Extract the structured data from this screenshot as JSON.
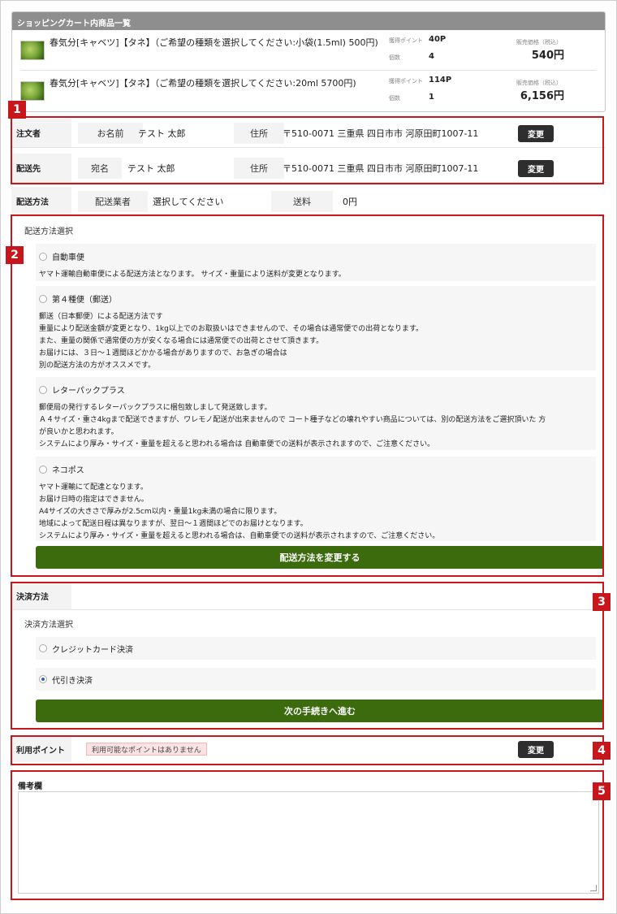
{
  "cart": {
    "header": "ショッピングカート内商品一覧",
    "items": [
      {
        "name": "春気分[キャベツ]【タネ】（ご希望の種類を選択してください:小袋(1.5ml) 500円)",
        "points_label": "獲得ポイント",
        "points": "40P",
        "qty_label": "個数",
        "qty": "4",
        "price_label": "販売価格（税込）",
        "price": "540円"
      },
      {
        "name": "春気分[キャベツ]【タネ】（ご希望の種類を選択してください:20ml 5700円)",
        "points_label": "獲得ポイント",
        "points": "114P",
        "qty_label": "個数",
        "qty": "1",
        "price_label": "販売価格（税込）",
        "price": "6,156円"
      }
    ]
  },
  "orderer": {
    "label": "注文者",
    "name_label": "お名前",
    "name": "テスト 太郎",
    "addr_label": "住所",
    "addr": "〒510-0071 三重県 四日市市 河原田町1007-11",
    "button": "変更"
  },
  "delivery": {
    "label": "配送先",
    "name_label": "宛名",
    "name": "テスト 太郎",
    "addr_label": "住所",
    "addr": "〒510-0071 三重県 四日市市 河原田町1007-11",
    "button": "変更"
  },
  "shipping": {
    "label": "配送方法",
    "carrier_label": "配送業者",
    "carrier_value": "選択してください",
    "fee_label": "送料",
    "fee_value": "0円",
    "select_title": "配送方法選択",
    "options": [
      {
        "name": "自動車便",
        "desc": [
          "ヤマト運輸自動車便による配送方法となります。 サイズ・重量により送料が変更となります。"
        ]
      },
      {
        "name": "第４種便（郵送）",
        "desc": [
          "郵送（日本郵便）による配送方法です",
          "重量により配送金額が変更となり、1kg以上でのお取扱いはできませんので、その場合は通常便での出荷となります。",
          "また、重量の関係で通常便の方が安くなる場合には通常便での出荷とさせて頂きます。",
          "お届けには、３日～１週間ほどかかる場合がありますので、お急ぎの場合は",
          "別の配送方法の方がオススメです。"
        ]
      },
      {
        "name": "レターパックプラス",
        "desc": [
          "郵便局の発行するレターパックプラスに梱包致しまして発送致します。",
          "Ａ４サイズ・重さ4kgまで配送できますが、ワレモノ配送が出来ませんので コート種子などの壊れやすい商品については、別の配送方法をご選択頂いた 方",
          "が良いかと思われます。",
          "システムにより厚み・サイズ・重量を超えると思われる場合は 自動車便での送料が表示されますので、ご注意ください。"
        ]
      },
      {
        "name": "ネコポス",
        "desc": [
          "ヤマト運輸にて配達となります。",
          "お届け日時の指定はできません。",
          "A4サイズの大きさで厚みが2.5cm以内・重量1kg未満の場合に限ります。",
          "地域によって配送日程は異なりますが、翌日～１週間ほどでのお届けとなります。",
          "システムにより厚み・サイズ・重量を超えると思われる場合は、自動車便での送料が表示されますので、ご注意ください。"
        ]
      }
    ],
    "change_button": "配送方法を変更する"
  },
  "payment": {
    "label": "決済方法",
    "select_title": "決済方法選択",
    "options": [
      "クレジットカード決済",
      "代引き決済"
    ],
    "selected": "代引き決済",
    "next_button": "次の手続きへ進む"
  },
  "points": {
    "label": "利用ポイント",
    "notice": "利用可能なポイントはありません",
    "button": "変更"
  },
  "memo": {
    "label": "備考欄"
  },
  "markers": [
    "1",
    "2",
    "3",
    "4",
    "5"
  ],
  "colors": {
    "highlight": "#c8161d",
    "primary_button": "#3b6b0c",
    "dark_button": "#2e2e2e",
    "cart_header": "#8e8e8e"
  }
}
